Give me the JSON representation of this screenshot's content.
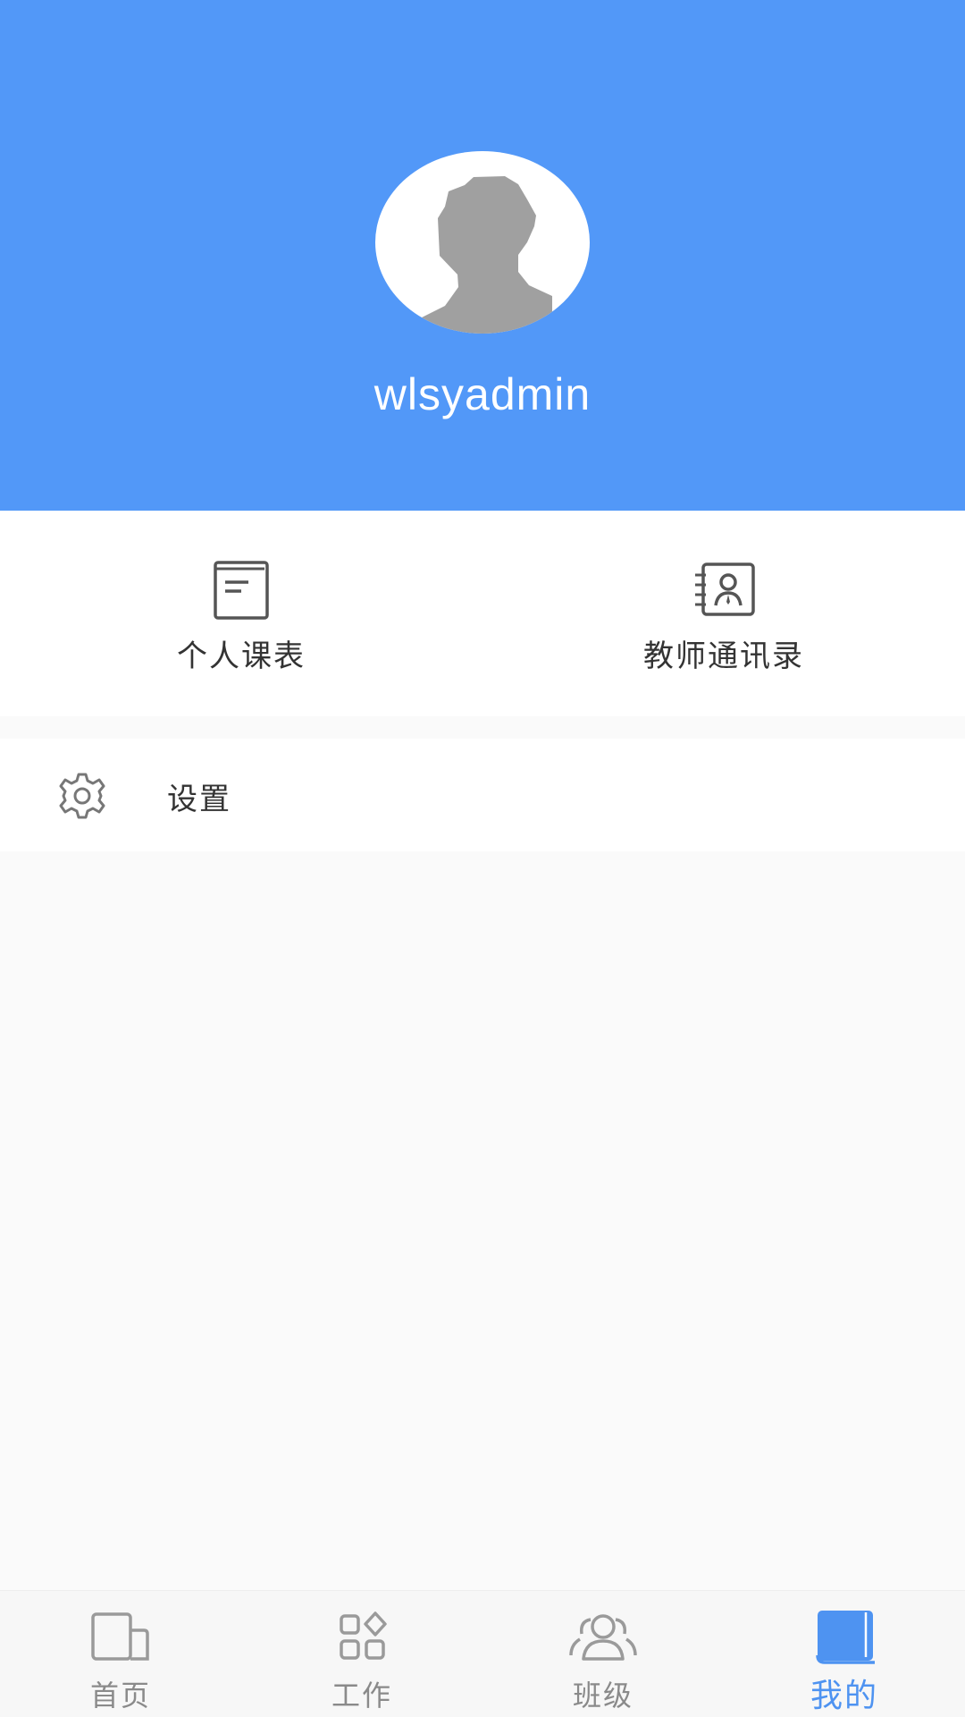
{
  "profile": {
    "username": "wlsyadmin"
  },
  "quick_links": [
    {
      "label": "个人课表",
      "icon": "timetable-icon"
    },
    {
      "label": "教师通讯录",
      "icon": "contacts-icon"
    }
  ],
  "settings": {
    "label": "设置",
    "icon": "gear-icon"
  },
  "tabbar": {
    "items": [
      {
        "label": "首页",
        "icon": "home-icon",
        "active": false
      },
      {
        "label": "工作",
        "icon": "apps-icon",
        "active": false
      },
      {
        "label": "班级",
        "icon": "group-icon",
        "active": false
      },
      {
        "label": "我的",
        "icon": "book-icon",
        "active": true
      }
    ]
  },
  "colors": {
    "header": "#5298f8",
    "active_tab": "#4e93f1",
    "inactive_tab": "#8a8a8a"
  }
}
